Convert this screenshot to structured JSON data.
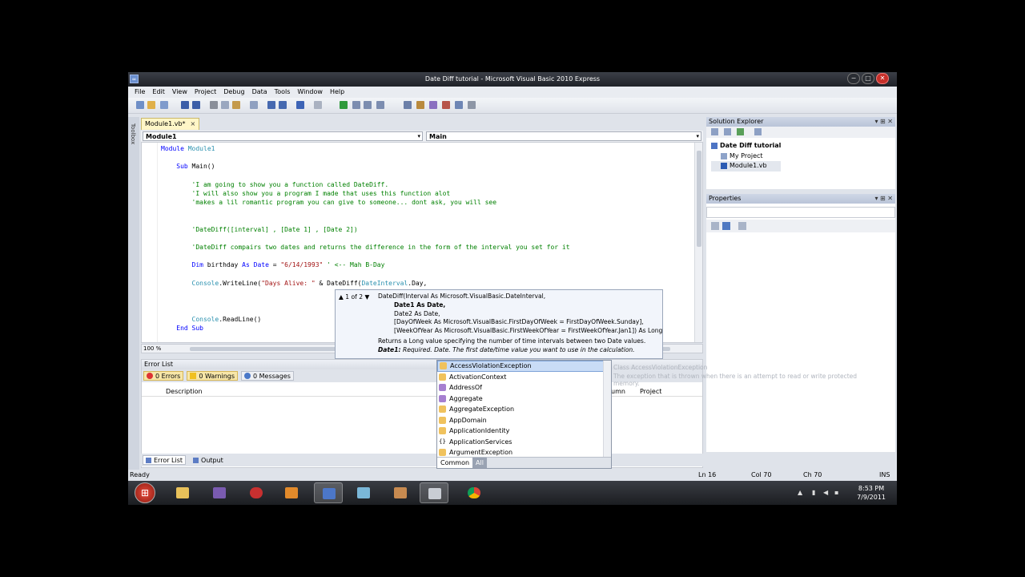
{
  "window": {
    "title": "Date Diff tutorial - Microsoft Visual Basic 2010 Express",
    "controls": [
      "−",
      "□",
      "✕"
    ]
  },
  "menu": [
    "File",
    "Edit",
    "View",
    "Project",
    "Debug",
    "Data",
    "Tools",
    "Window",
    "Help"
  ],
  "toolbox_label": "Toolbox",
  "editor": {
    "tab_label": "Module1.vb*",
    "tab_close": "×",
    "combo_left": "Module1",
    "combo_right": "Main",
    "zoom": "100 %"
  },
  "code_lines": [
    [
      {
        "t": "kw",
        "v": "Module"
      },
      {
        "t": "",
        "v": " "
      },
      {
        "t": "ty",
        "v": "Module1"
      }
    ],
    [],
    [
      {
        "t": "",
        "v": "    "
      },
      {
        "t": "kw",
        "v": "Sub"
      },
      {
        "t": "",
        "v": " Main()"
      }
    ],
    [],
    [
      {
        "t": "",
        "v": "        "
      },
      {
        "t": "cm",
        "v": "'I am going to show you a function called DateDiff."
      }
    ],
    [
      {
        "t": "",
        "v": "        "
      },
      {
        "t": "cm",
        "v": "'I will also show you a program I made that uses this function alot"
      }
    ],
    [
      {
        "t": "",
        "v": "        "
      },
      {
        "t": "cm",
        "v": "'makes a lil romantic program you can give to someone... dont ask, you will see"
      }
    ],
    [],
    [],
    [
      {
        "t": "",
        "v": "        "
      },
      {
        "t": "cm",
        "v": "'DateDiff([interval] , [Date 1] , [Date 2])"
      }
    ],
    [],
    [
      {
        "t": "",
        "v": "        "
      },
      {
        "t": "cm",
        "v": "'DateDiff compairs two dates and returns the difference in the form of the interval you set for it"
      }
    ],
    [],
    [
      {
        "t": "",
        "v": "        "
      },
      {
        "t": "kw",
        "v": "Dim"
      },
      {
        "t": "",
        "v": " birthday "
      },
      {
        "t": "kw",
        "v": "As"
      },
      {
        "t": "",
        "v": " "
      },
      {
        "t": "kw",
        "v": "Date"
      },
      {
        "t": "",
        "v": " = "
      },
      {
        "t": "st",
        "v": "\"6/14/1993\""
      },
      {
        "t": "",
        "v": " "
      },
      {
        "t": "cm",
        "v": "' <-- Mah B-Day"
      }
    ],
    [],
    [
      {
        "t": "",
        "v": "        "
      },
      {
        "t": "ty",
        "v": "Console"
      },
      {
        "t": "",
        "v": ".WriteLine("
      },
      {
        "t": "st",
        "v": "\"Days Alive: \""
      },
      {
        "t": "",
        "v": " & DateDiff("
      },
      {
        "t": "ty",
        "v": "DateInterval"
      },
      {
        "t": "",
        "v": ".Day,"
      }
    ],
    [],
    [],
    [],
    [
      {
        "t": "",
        "v": "        "
      },
      {
        "t": "ty",
        "v": "Console"
      },
      {
        "t": "",
        "v": ".ReadLine()"
      }
    ],
    [
      {
        "t": "",
        "v": "    "
      },
      {
        "t": "kw",
        "v": "End Sub"
      }
    ]
  ],
  "param_info": {
    "nav": "1 of 2",
    "sig_line1": "DateDiff(Interval As Microsoft.VisualBasic.DateInterval,",
    "sig_line2": "Date1 As Date,",
    "sig_line3": "Date2 As Date,",
    "sig_line4": "[DayOfWeek As Microsoft.VisualBasic.FirstDayOfWeek = FirstDayOfWeek.Sunday],",
    "sig_line5": "[WeekOfYear As Microsoft.VisualBasic.FirstWeekOfYear = FirstWeekOfYear.Jan1]) As Long",
    "desc": "Returns a Long value specifying the number of time intervals between two Date values.",
    "param_name": "Date1:",
    "param_desc": "Required. Date. The first date/time value you want to use in the calculation."
  },
  "completion": {
    "items": [
      {
        "label": "AccessViolationException",
        "kind": "class"
      },
      {
        "label": "ActivationContext",
        "kind": "class"
      },
      {
        "label": "AddressOf",
        "kind": "keyword"
      },
      {
        "label": "Aggregate",
        "kind": "keyword"
      },
      {
        "label": "AggregateException",
        "kind": "class"
      },
      {
        "label": "AppDomain",
        "kind": "class"
      },
      {
        "label": "ApplicationIdentity",
        "kind": "class"
      },
      {
        "label": "ApplicationServices",
        "kind": "namespace"
      },
      {
        "label": "ArgumentException",
        "kind": "class"
      }
    ],
    "tab_common": "Common",
    "tab_all": "All",
    "tooltip_line1": "Class AccessViolationException",
    "tooltip_line2": "The exception that is thrown when there is an attempt to read or write protected memory."
  },
  "error_list": {
    "title": "Error List",
    "errors": "0 Errors",
    "warnings": "0 Warnings",
    "messages": "0 Messages",
    "col_description": "Description",
    "col_column": "umn",
    "col_project": "Project"
  },
  "bottom_tabs": [
    "Error List",
    "Output"
  ],
  "solution_explorer": {
    "title": "Solution Explorer",
    "items": [
      "Date Diff tutorial",
      "My Project",
      "Module1.vb"
    ]
  },
  "properties": {
    "title": "Properties"
  },
  "status": {
    "text": "Ready",
    "ln": "Ln 16",
    "col": "Col 70",
    "ch": "Ch 70",
    "ins": "INS"
  },
  "taskbar": {
    "time": "8:53 PM",
    "date": "7/9/2011"
  },
  "colors": {
    "keyword": "#0000ff",
    "comment": "#008000",
    "string": "#a31515",
    "type": "#2b91af",
    "selection": "#c9dcf6"
  }
}
